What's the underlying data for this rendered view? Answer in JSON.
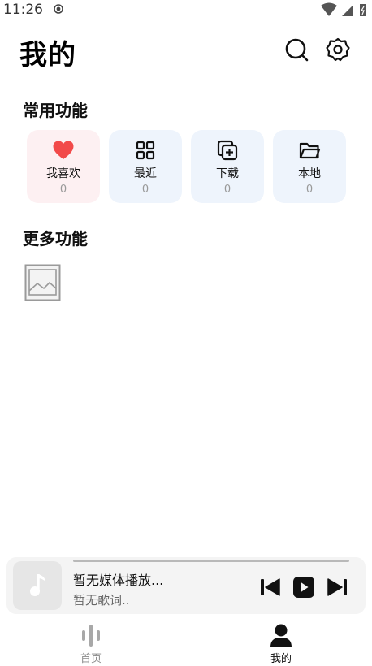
{
  "status_bar": {
    "time": "11:26"
  },
  "header": {
    "title": "我的"
  },
  "sections": {
    "common_title": "常用功能",
    "more_title": "更多功能"
  },
  "cards": [
    {
      "label": "我喜欢",
      "count": "0",
      "icon": "heart-icon"
    },
    {
      "label": "最近",
      "count": "0",
      "icon": "grid-icon"
    },
    {
      "label": "下载",
      "count": "0",
      "icon": "add-copy-icon"
    },
    {
      "label": "本地",
      "count": "0",
      "icon": "folder-icon"
    }
  ],
  "player": {
    "title": "暂无媒体播放...",
    "lyric": "暂无歌词.."
  },
  "nav": {
    "home_label": "首页",
    "mine_label": "我的"
  },
  "colors": {
    "heart": "#f24a4a",
    "card_bg": "#eef4fc",
    "fav_bg": "#fdf0f2"
  }
}
